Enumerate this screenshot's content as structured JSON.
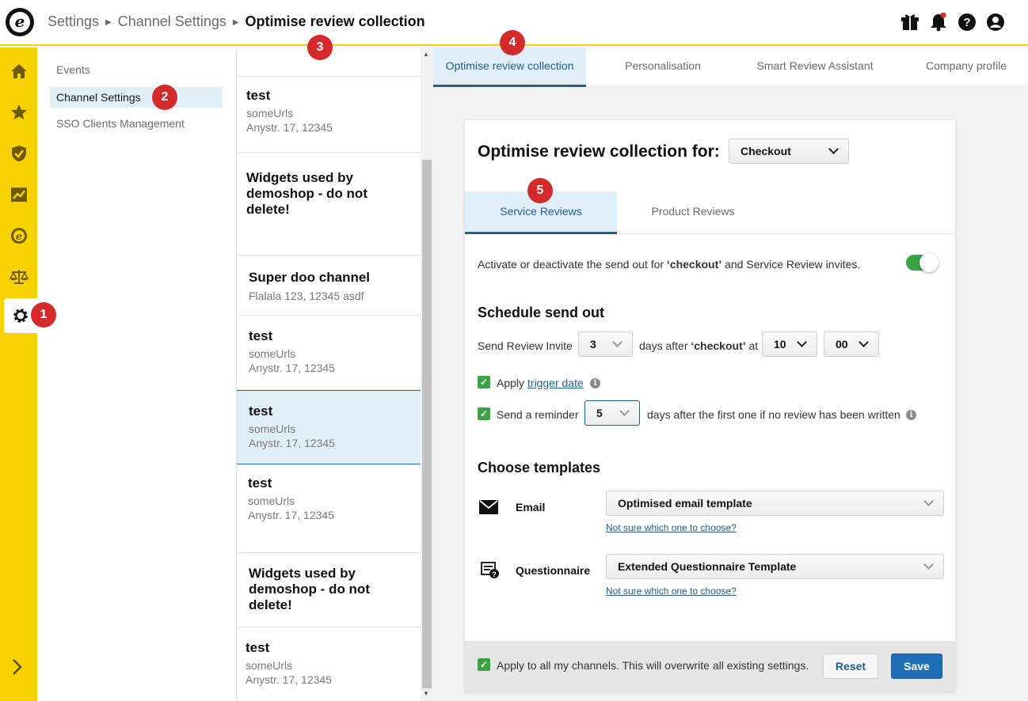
{
  "header": {
    "logo_letter": "e",
    "breadcrumb": [
      "Settings",
      "Channel Settings",
      "Optimise review collection"
    ]
  },
  "icons": {
    "top": [
      "gift-icon",
      "bell-icon",
      "help-icon",
      "user-icon"
    ],
    "rail": [
      "home-icon",
      "star-icon",
      "shield-icon",
      "chart-icon",
      "trusted-icon",
      "scale-icon",
      "gear-icon",
      "chevron-right-icon"
    ]
  },
  "submenu": {
    "items": [
      "Events",
      "Channel Settings",
      "SSO Clients Management"
    ],
    "active_index": 1
  },
  "channels": [
    {
      "name": "test",
      "lines": [
        "someUrls",
        "Anystr. 17, 12345"
      ]
    },
    {
      "name": "Widgets used by demoshop - do not delete!",
      "lines": []
    },
    {
      "name": "Super doo channel",
      "lines": [
        "Flalala 123, 12345 asdf"
      ]
    },
    {
      "name": "test",
      "lines": [
        "someUrls",
        "Anystr. 17, 12345"
      ]
    },
    {
      "name": "test",
      "lines": [
        "someUrls",
        "Anystr. 17, 12345"
      ]
    },
    {
      "name": "test",
      "lines": [
        "someUrls",
        "Anystr. 17, 12345"
      ]
    },
    {
      "name": "Widgets used by demoshop - do not delete!",
      "lines": []
    },
    {
      "name": "test",
      "lines": [
        "someUrls",
        "Anystr. 17, 12345"
      ]
    }
  ],
  "main_tabs": [
    "Optimise review collection",
    "Personalisation",
    "Smart Review Assistant",
    "Company profile"
  ],
  "card": {
    "title": "Optimise review collection for:",
    "channel_select": "Checkout",
    "subtabs": [
      "Service Reviews",
      "Product Reviews"
    ],
    "activate_text_1": "Activate or deactivate the send out for ",
    "activate_bold": "‘checkout’",
    "activate_text_2": " and Service Review invites.",
    "schedule_title": "Schedule send out",
    "send_invite_label": "Send Review Invite",
    "days_value": "3",
    "days_after_text": "days after ",
    "days_after_bold": "‘checkout’",
    "at_text": " at",
    "hour_value": "10",
    "minute_value": "00",
    "apply_text": "Apply ",
    "trigger_link": "trigger date",
    "reminder_label": "Send a reminder",
    "reminder_value": "5",
    "reminder_after": "days after the first one if no review has been written",
    "templates_title": "Choose templates",
    "email_label": "Email",
    "email_template": "Optimised email template",
    "email_help": "Not sure which one to choose?",
    "questionnaire_label": "Questionnaire",
    "questionnaire_template": "Extended Questionnaire Template",
    "questionnaire_help": "Not sure which one to choose?",
    "apply_all": "Apply to all my channels. This will overwrite all existing settings.",
    "reset_label": "Reset",
    "save_label": "Save",
    "info_glyph": "i",
    "check_glyph": "✓"
  },
  "badges": [
    "1",
    "2",
    "3",
    "4",
    "5"
  ],
  "colors": {
    "accent": "#f8d200",
    "primary": "#1f6fb5",
    "selected": "#dfeef7",
    "success": "#39a346",
    "badge": "#d32b2b"
  }
}
